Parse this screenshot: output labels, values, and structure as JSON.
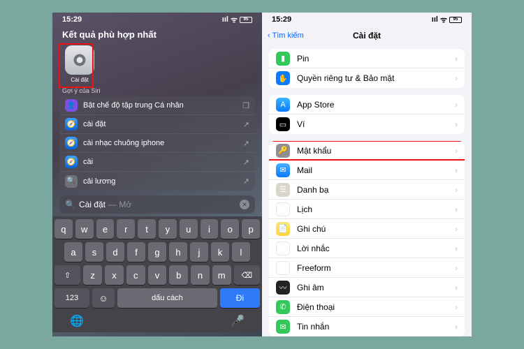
{
  "status": {
    "time": "15:29",
    "battery": "95"
  },
  "left": {
    "header": "Kết quả phù hợp nhất",
    "top_app_label": "Cài đặt",
    "siri_hint": "Gợi ý của Siri",
    "suggestions": [
      {
        "label": "Bật chế độ tập trung Cá nhân",
        "icon": "focus",
        "tail_icon": "layers"
      },
      {
        "label": "cài đặt",
        "icon": "safari",
        "tail_icon": "arrow"
      },
      {
        "label": "cài nhạc chuông iphone",
        "icon": "safari",
        "tail_icon": "arrow"
      },
      {
        "label": "cài",
        "icon": "safari",
        "tail_icon": "arrow"
      },
      {
        "label": "cải lương",
        "icon": "search",
        "tail_icon": "arrow"
      }
    ],
    "search": {
      "typed": "Cài đặt",
      "hint": "— Mở"
    },
    "keyboard": {
      "row1": [
        "q",
        "w",
        "e",
        "r",
        "t",
        "y",
        "u",
        "i",
        "o",
        "p"
      ],
      "row2": [
        "a",
        "s",
        "d",
        "f",
        "g",
        "h",
        "j",
        "k",
        "l"
      ],
      "row3_shift": "⇧",
      "row3": [
        "z",
        "x",
        "c",
        "v",
        "b",
        "n",
        "m"
      ],
      "row3_del": "⌫",
      "num": "123",
      "emoji": "☺",
      "space": "dấu cách",
      "go": "Đi"
    }
  },
  "right": {
    "back": "Tìm kiếm",
    "title": "Cài đặt",
    "group1": [
      {
        "label": "Pin",
        "icon": "ic-green",
        "glyph": "▮"
      },
      {
        "label": "Quyền riêng tư & Bảo mật",
        "icon": "ic-blue",
        "glyph": "✋"
      }
    ],
    "group2": [
      {
        "label": "App Store",
        "icon": "ic-appstore",
        "glyph": "A"
      },
      {
        "label": "Ví",
        "icon": "ic-wallet",
        "glyph": "▭"
      }
    ],
    "group3": [
      {
        "label": "Mật khẩu",
        "icon": "ic-gray",
        "glyph": "🔑",
        "highlight": true
      },
      {
        "label": "Mail",
        "icon": "ic-mail",
        "glyph": "✉"
      },
      {
        "label": "Danh bạ",
        "icon": "ic-contacts",
        "glyph": "☰"
      },
      {
        "label": "Lịch",
        "icon": "ic-cal",
        "glyph": ""
      },
      {
        "label": "Ghi chú",
        "icon": "ic-notes",
        "glyph": "📄"
      },
      {
        "label": "Lời nhắc",
        "icon": "ic-remind",
        "glyph": "•"
      },
      {
        "label": "Freeform",
        "icon": "ic-freeform",
        "glyph": "✎"
      },
      {
        "label": "Ghi âm",
        "icon": "ic-voice",
        "glyph": "〰"
      },
      {
        "label": "Điện thoại",
        "icon": "ic-phone",
        "glyph": "✆"
      },
      {
        "label": "Tin nhắn",
        "icon": "ic-msg",
        "glyph": "✉"
      }
    ]
  }
}
